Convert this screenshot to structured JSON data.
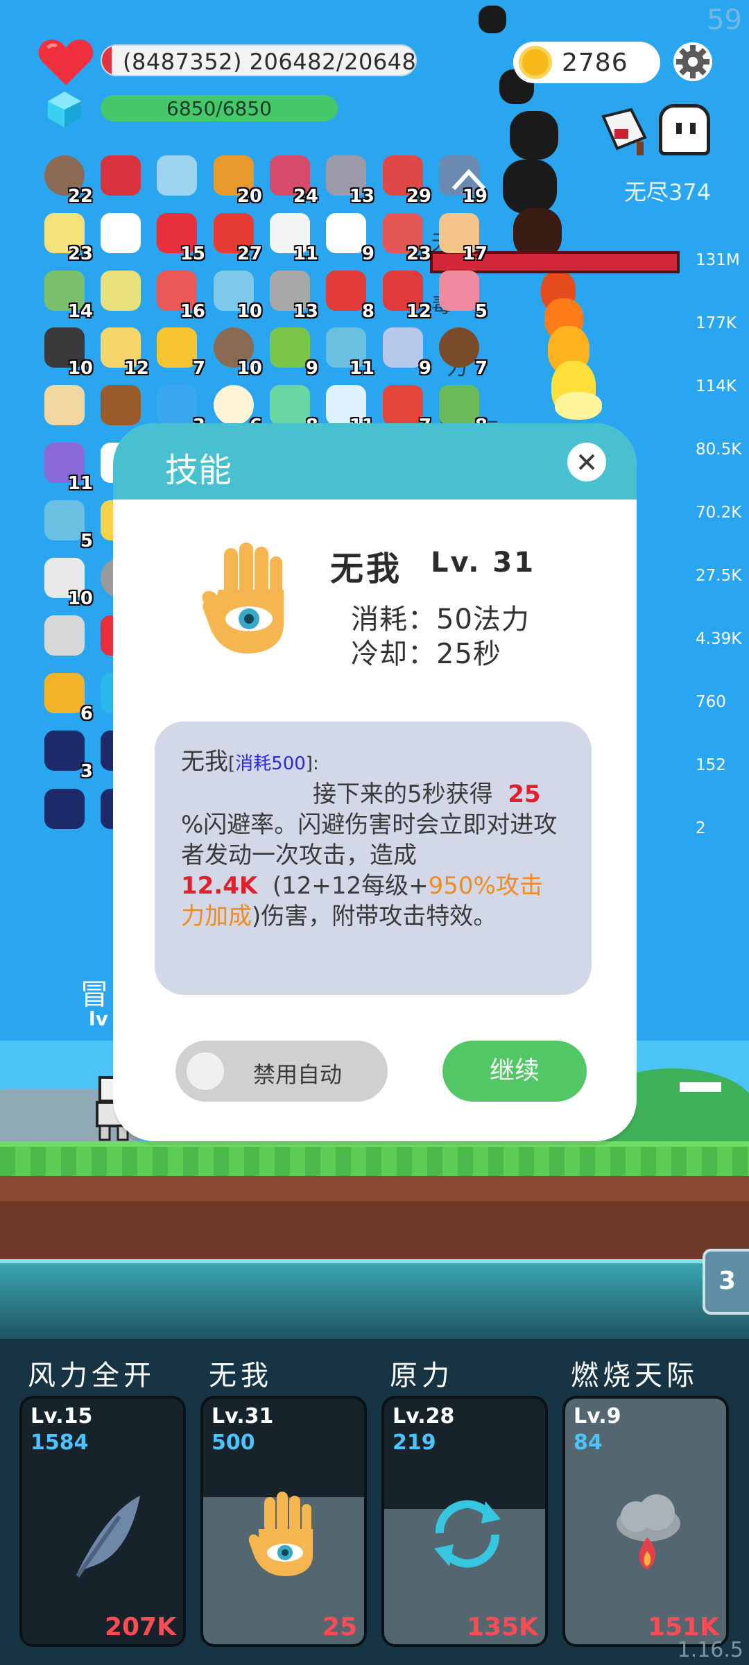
{
  "hud": {
    "fps": "59",
    "hp_text": "(8487352) 206482/206482",
    "mp_text": "6850/6850",
    "gold": "2786",
    "endless_label": "无尽374"
  },
  "side_stats": [
    "131M",
    "177K",
    "114K",
    "80.5K",
    "70.2K",
    "27.5K",
    "4.39K",
    "760",
    "152",
    "2"
  ],
  "enemy": {
    "name_1": "无我",
    "name_2": "毒",
    "name_3": "力",
    "name_4": "烧天际"
  },
  "inventory": [
    {
      "icon": "disc-icon",
      "count": "22"
    },
    {
      "icon": "magnet-icon",
      "count": ""
    },
    {
      "icon": "magnifier-icon",
      "count": ""
    },
    {
      "icon": "book-icon",
      "count": "20"
    },
    {
      "icon": "jam-jar-icon",
      "count": "24"
    },
    {
      "icon": "bat-icon",
      "count": "13"
    },
    {
      "icon": "sock-icon",
      "count": "29"
    },
    {
      "icon": "shield-icon",
      "count": "19"
    },
    {
      "icon": "flower-icon",
      "count": "23"
    },
    {
      "icon": "wing-icon",
      "count": ""
    },
    {
      "icon": "heart-icon",
      "count": "15"
    },
    {
      "icon": "apple-icon",
      "count": "27"
    },
    {
      "icon": "mail-icon",
      "count": "11"
    },
    {
      "icon": "ghost-icon",
      "count": "9"
    },
    {
      "icon": "watermelon-icon",
      "count": "23"
    },
    {
      "icon": "hand-icon",
      "count": "17"
    },
    {
      "icon": "cash-icon",
      "count": "14"
    },
    {
      "icon": "chain-icon",
      "count": ""
    },
    {
      "icon": "pill-icon",
      "count": "16"
    },
    {
      "icon": "potion-icon",
      "count": "10"
    },
    {
      "icon": "tombstone-icon",
      "count": "13"
    },
    {
      "icon": "mushroom-icon",
      "count": "8"
    },
    {
      "icon": "strawberry-icon",
      "count": "12"
    },
    {
      "icon": "spray-icon",
      "count": "5"
    },
    {
      "icon": "cauldron-icon",
      "count": "10"
    },
    {
      "icon": "notepad-icon",
      "count": "12"
    },
    {
      "icon": "sunflower-icon",
      "count": "7"
    },
    {
      "icon": "disc-icon",
      "count": "10"
    },
    {
      "icon": "lime-icon",
      "count": "9"
    },
    {
      "icon": "scroll-icon",
      "count": "11"
    },
    {
      "icon": "capsule-icon",
      "count": "9"
    },
    {
      "icon": "coconut-icon",
      "count": "7"
    },
    {
      "icon": "map-icon",
      "count": ""
    },
    {
      "icon": "chest-icon",
      "count": ""
    },
    {
      "icon": "chat-icon",
      "count": "3"
    },
    {
      "icon": "egg-icon",
      "count": "6"
    },
    {
      "icon": "alien-icon",
      "count": "8"
    },
    {
      "icon": "halo-icon",
      "count": "11"
    },
    {
      "icon": "gift-icon",
      "count": "7"
    },
    {
      "icon": "zombie-icon",
      "count": "8"
    },
    {
      "icon": "star-shield-icon",
      "count": "11"
    },
    {
      "icon": "cloud-icon",
      "count": ""
    },
    {
      "icon": "scroll-icon",
      "count": "5"
    },
    {
      "icon": "sun-icon",
      "count": ""
    },
    {
      "icon": "bomb-icon",
      "count": "10"
    },
    {
      "icon": "ball-icon",
      "count": ""
    },
    {
      "icon": "pendulum-icon",
      "count": ""
    },
    {
      "icon": "heart-icon",
      "count": ""
    },
    {
      "icon": "coins-icon",
      "count": "6"
    },
    {
      "icon": "hex-icon",
      "count": ""
    },
    {
      "icon": "tile-icon",
      "count": "3"
    },
    {
      "icon": "tile-icon",
      "count": ""
    },
    {
      "icon": "tile-icon",
      "count": ""
    },
    {
      "icon": "tile-icon",
      "count": ""
    }
  ],
  "hero": {
    "name": "冒",
    "level": "lv"
  },
  "modal": {
    "title": "技能",
    "skill_name": "无我",
    "skill_level": "Lv. 31",
    "cost_line": "消耗：50法力",
    "cooldown_line": "冷却：25秒",
    "desc_name": "无我",
    "desc_cost_open": "[",
    "desc_cost": "消耗500",
    "desc_cost_close": "]:",
    "desc_part1": "接下来的5秒获得",
    "desc_val1": "25",
    "desc_part2": "%闪避率。闪避伤害时会立即对进攻者发动一次攻击，造成",
    "desc_val2": "12.4K",
    "desc_part3": "(12+12每级+",
    "desc_val3": "950%攻击力加成",
    "desc_part4": ")伤害，附带攻击特效。",
    "toggle_label": "禁用自动",
    "continue_label": "继续"
  },
  "side_tab": "3",
  "skills": [
    {
      "name": "风力全开",
      "level": "Lv.15",
      "cost": "1584",
      "damage": "207K",
      "icon": "feather-icon",
      "fill": 0
    },
    {
      "name": "无我",
      "level": "Lv.31",
      "cost": "500",
      "damage": "25",
      "icon": "hand-eye-icon",
      "fill": 0.6
    },
    {
      "name": "原力",
      "level": "Lv.28",
      "cost": "219",
      "damage": "135K",
      "icon": "cycle-icon",
      "fill": 0.55
    },
    {
      "name": "燃烧天际",
      "level": "Lv.9",
      "cost": "84",
      "damage": "151K",
      "icon": "fire-cloud-icon",
      "fill": 1
    }
  ],
  "version": "1.16.5",
  "colors": {
    "sky": "#2aa6f0",
    "modal_header": "#49c0cf",
    "continue": "#52c765",
    "damage": "#ff4b55",
    "cost": "#4ec4ff"
  }
}
